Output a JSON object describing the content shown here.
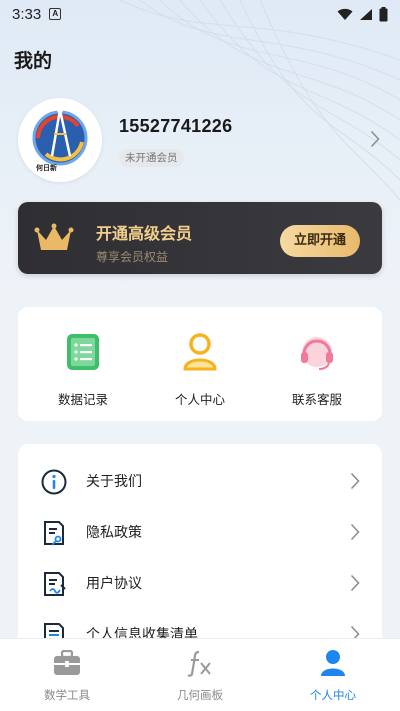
{
  "status_bar": {
    "time": "3:33",
    "notif_glyph": "A"
  },
  "page": {
    "title": "我的"
  },
  "profile": {
    "phone": "15527741226",
    "membership": "未开通会员",
    "avatar_logo_text": "何日新"
  },
  "vip": {
    "title": "开通高级会员",
    "subtitle": "尊享会员权益",
    "button": "立即开通",
    "colors": {
      "card": "#333337",
      "gold": "#f2cf8c"
    }
  },
  "quick_actions": [
    {
      "label": "数据记录",
      "icon": "document-list-icon"
    },
    {
      "label": "个人中心",
      "icon": "person-icon"
    },
    {
      "label": "联系客服",
      "icon": "headset-icon"
    }
  ],
  "menu": [
    {
      "label": "关于我们",
      "icon": "info-icon"
    },
    {
      "label": "隐私政策",
      "icon": "privacy-document-icon"
    },
    {
      "label": "用户协议",
      "icon": "agreement-document-icon"
    },
    {
      "label": "个人信息收集清单",
      "icon": "list-document-icon"
    }
  ],
  "tabbar": {
    "active": "个人中心",
    "accent": "#1f86ee",
    "tabs": [
      {
        "label": "数学工具",
        "icon": "toolbox-icon"
      },
      {
        "label": "几何画板",
        "icon": "fx-icon"
      },
      {
        "label": "个人中心",
        "icon": "person-icon"
      }
    ]
  }
}
